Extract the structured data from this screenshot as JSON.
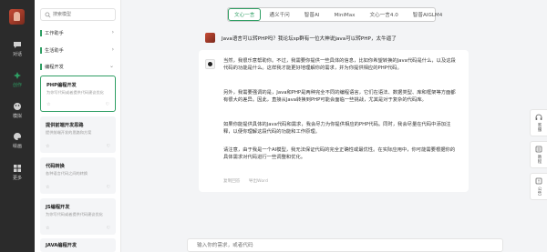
{
  "nav": {
    "items": [
      {
        "label": "对话",
        "icon": "chat-icon",
        "active": false
      },
      {
        "label": "创作",
        "icon": "create-icon",
        "active": true
      },
      {
        "label": "模拟",
        "icon": "simulate-icon",
        "active": false
      },
      {
        "label": "绘画",
        "icon": "paint-icon",
        "active": false
      },
      {
        "label": "更多",
        "icon": "more-icon",
        "active": false
      }
    ]
  },
  "panel": {
    "search_placeholder": "搜索模型",
    "categories": [
      {
        "label": "工作助手",
        "chevron": "›"
      },
      {
        "label": "生活助手",
        "chevron": "›"
      },
      {
        "label": "编程开发",
        "chevron": "⌄"
      }
    ],
    "cards": [
      {
        "title": "PHP编程开发",
        "desc": "为你写代码或者提供代码建议优化",
        "active": true
      },
      {
        "title": "提供前端开发思路",
        "desc": "提供前端开发的思路和方案",
        "active": false
      },
      {
        "title": "代码转换",
        "desc": "各种语言代码之间的转换",
        "active": false
      },
      {
        "title": "JS编程开发",
        "desc": "为你写代码或者提供代码建议优化",
        "active": false
      },
      {
        "title": "JAVA编程开发",
        "desc": "",
        "active": false
      }
    ]
  },
  "tabs": [
    {
      "label": "文心一言",
      "active": true
    },
    {
      "label": "通义千问",
      "active": false
    },
    {
      "label": "智普AI",
      "active": false
    },
    {
      "label": "MiniMax",
      "active": false
    },
    {
      "label": "文心一言4.0",
      "active": false
    },
    {
      "label": "智普AIGLM4",
      "active": false
    }
  ],
  "conversation": {
    "question": "Java语言可以转PHP吗？我论坛sp群有一位大神说Java可以转PHP，太牛逼了",
    "answer_paragraphs": [
      "当然，我很乐意帮助你。不过，我需要你提供一些具体的信息，比如你希望转换的Java代码是什么，以及这段代码的功能是什么。这样我才能更好地理解你的需求，并为你提供相应的PHP代码。",
      "另外，我需要强调的是，Java和PHP是两种完全不同的编程语言，它们在语法、数据类型、库和框架等方面都有很大的差异。因此，直接从Java转换到PHP可能会面临一些挑战，尤其是对于复杂的代码库。",
      "如果你能提供具体的Java代码和需求，我会尽力为你提供相应的PHP代码。同时，我会尽量在代码中添加注释，以便你理解这段代码的功能和工作原理。",
      "请注意，由于我是一个AI模型，我无法保证代码的完全正确性或最优性。在实际应用中，你可能需要根据你的具体需求对代码进行一些调整和优化。"
    ],
    "actions": [
      "复制回答",
      "导出Word"
    ]
  },
  "input": {
    "placeholder": "输入你的需求，或者代码"
  },
  "floats": [
    {
      "label": "客服",
      "icon": "service-icon"
    },
    {
      "label": "教程",
      "icon": "tutorial-icon"
    },
    {
      "label": "公告",
      "icon": "notice-icon"
    }
  ],
  "colors": {
    "accent": "#2e9e63",
    "rail": "#2b2b2b",
    "background": "#f3f4f6"
  }
}
